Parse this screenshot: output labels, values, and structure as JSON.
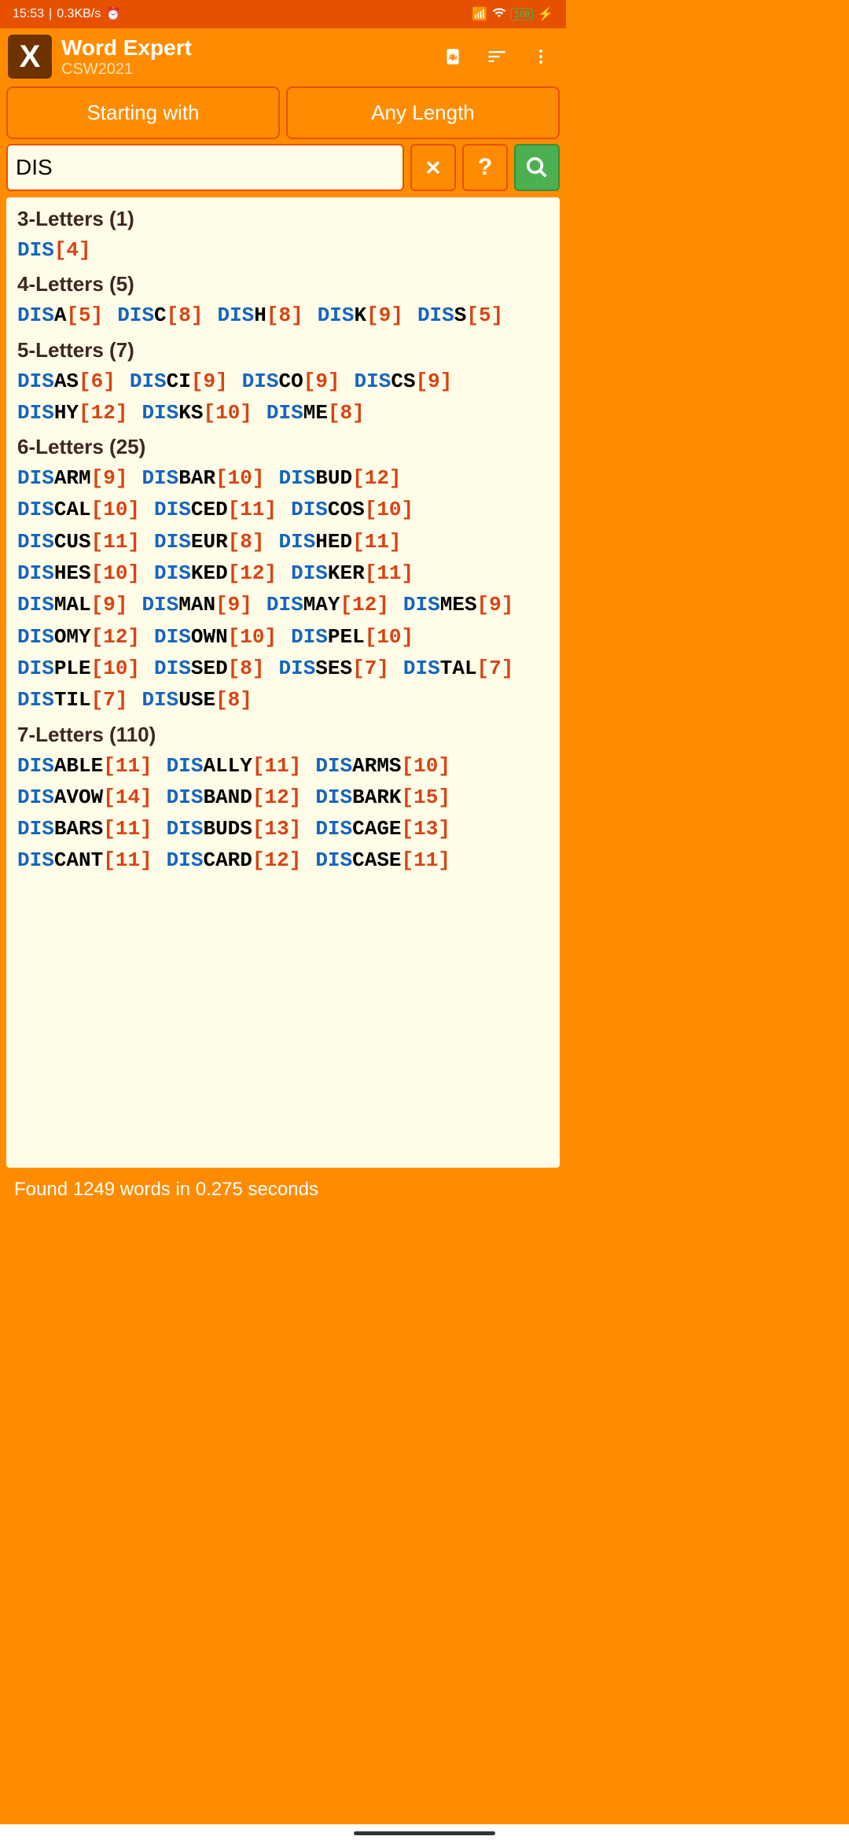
{
  "status": {
    "time": "15:53",
    "speed": "0.3KB/s",
    "battery": "100"
  },
  "header": {
    "title": "Word Expert",
    "subtitle": "CSW2021"
  },
  "filters": {
    "mode": "Starting with",
    "length": "Any Length"
  },
  "search": {
    "value": "DIS"
  },
  "prefix": "DIS",
  "groups": [
    {
      "title": "3-Letters (1)",
      "words": [
        {
          "suffix": "",
          "score": 4
        }
      ]
    },
    {
      "title": "4-Letters (5)",
      "words": [
        {
          "suffix": "A",
          "score": 5
        },
        {
          "suffix": "C",
          "score": 8
        },
        {
          "suffix": "H",
          "score": 8
        },
        {
          "suffix": "K",
          "score": 9
        },
        {
          "suffix": "S",
          "score": 5
        }
      ]
    },
    {
      "title": "5-Letters (7)",
      "words": [
        {
          "suffix": "AS",
          "score": 6
        },
        {
          "suffix": "CI",
          "score": 9
        },
        {
          "suffix": "CO",
          "score": 9
        },
        {
          "suffix": "CS",
          "score": 9
        },
        {
          "suffix": "HY",
          "score": 12
        },
        {
          "suffix": "KS",
          "score": 10
        },
        {
          "suffix": "ME",
          "score": 8
        }
      ]
    },
    {
      "title": "6-Letters (25)",
      "words": [
        {
          "suffix": "ARM",
          "score": 9
        },
        {
          "suffix": "BAR",
          "score": 10
        },
        {
          "suffix": "BUD",
          "score": 12
        },
        {
          "suffix": "CAL",
          "score": 10
        },
        {
          "suffix": "CED",
          "score": 11
        },
        {
          "suffix": "COS",
          "score": 10
        },
        {
          "suffix": "CUS",
          "score": 11
        },
        {
          "suffix": "EUR",
          "score": 8
        },
        {
          "suffix": "HED",
          "score": 11
        },
        {
          "suffix": "HES",
          "score": 10
        },
        {
          "suffix": "KED",
          "score": 12
        },
        {
          "suffix": "KER",
          "score": 11
        },
        {
          "suffix": "MAL",
          "score": 9
        },
        {
          "suffix": "MAN",
          "score": 9
        },
        {
          "suffix": "MAY",
          "score": 12
        },
        {
          "suffix": "MES",
          "score": 9
        },
        {
          "suffix": "OMY",
          "score": 12
        },
        {
          "suffix": "OWN",
          "score": 10
        },
        {
          "suffix": "PEL",
          "score": 10
        },
        {
          "suffix": "PLE",
          "score": 10
        },
        {
          "suffix": "SED",
          "score": 8
        },
        {
          "suffix": "SES",
          "score": 7
        },
        {
          "suffix": "TAL",
          "score": 7
        },
        {
          "suffix": "TIL",
          "score": 7
        },
        {
          "suffix": "USE",
          "score": 8
        }
      ]
    },
    {
      "title": "7-Letters (110)",
      "words": [
        {
          "suffix": "ABLE",
          "score": 11
        },
        {
          "suffix": "ALLY",
          "score": 11
        },
        {
          "suffix": "ARMS",
          "score": 10
        },
        {
          "suffix": "AVOW",
          "score": 14
        },
        {
          "suffix": "BAND",
          "score": 12
        },
        {
          "suffix": "BARK",
          "score": 15
        },
        {
          "suffix": "BARS",
          "score": 11
        },
        {
          "suffix": "BUDS",
          "score": 13
        },
        {
          "suffix": "CAGE",
          "score": 13
        },
        {
          "suffix": "CANT",
          "score": 11
        },
        {
          "suffix": "CARD",
          "score": 12
        },
        {
          "suffix": "CASE",
          "score": 11
        }
      ]
    }
  ],
  "footer": {
    "text": "Found 1249 words in 0.275 seconds"
  }
}
